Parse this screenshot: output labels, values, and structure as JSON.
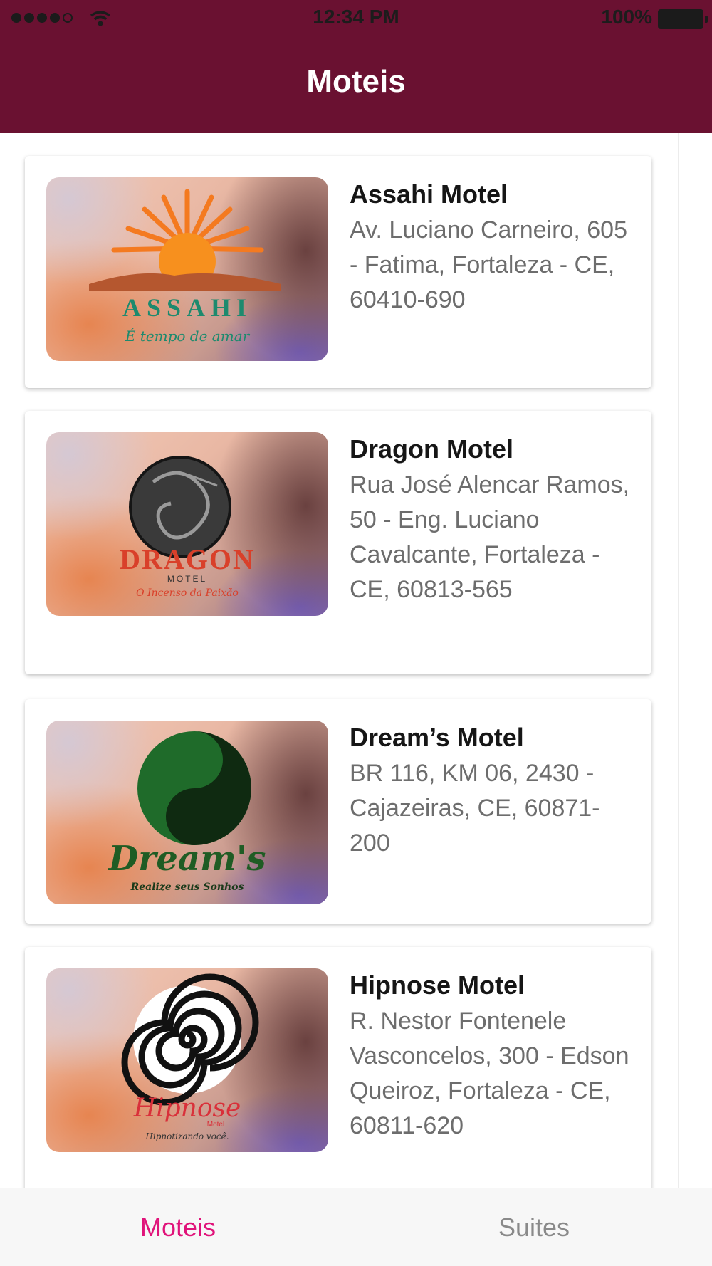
{
  "status_bar": {
    "time": "12:34 PM",
    "battery": "100%",
    "signal_bars": 4
  },
  "nav": {
    "title": "Moteis"
  },
  "motels": [
    {
      "name": "Assahi Motel",
      "address": "Av. Luciano Carneiro, 605 - Fatima, Fortaleza - CE, 60410-690",
      "logo_text": "ASSAHI",
      "logo_tagline": "É tempo de amar"
    },
    {
      "name": "Dragon Motel",
      "address": "Rua José Alencar Ramos, 50 - Eng. Luciano Cavalcante, Fortaleza - CE, 60813-565",
      "logo_text": "DRAGON",
      "logo_subtext": "MOTEL",
      "logo_tagline": "O Incenso da Paixão"
    },
    {
      "name": "Dream’s Motel",
      "address": "BR 116, KM 06, 2430 - Cajazeiras, CE, 60871-200",
      "logo_text": "Dream's",
      "logo_tagline": "Realize seus Sonhos"
    },
    {
      "name": "Hipnose Motel",
      "address": "R. Nestor Fontenele Vasconcelos, 300 - Edson Queiroz, Fortaleza - CE, 60811-620",
      "logo_text": "Hipnose",
      "logo_subtext": "Motel",
      "logo_tagline": "Hipnotizando você."
    }
  ],
  "tabs": [
    {
      "label": "Moteis",
      "active": true
    },
    {
      "label": "Suites",
      "active": false
    }
  ],
  "colors": {
    "header": "#6a1131",
    "active_tab": "#e0137a",
    "inactive_tab": "#8a8a8a",
    "assahi_orange": "#f47a20",
    "assahi_green": "#1d8a6e",
    "dragon_red": "#d9402a",
    "dreams_green": "#1f5c24"
  }
}
